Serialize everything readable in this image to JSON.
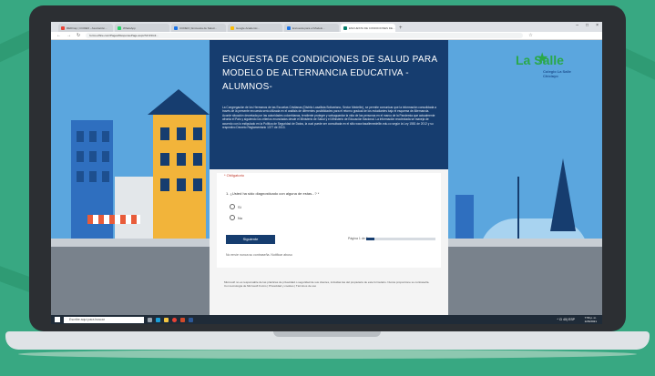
{
  "browser": {
    "tabs": [
      {
        "label": "REDCap | CCDEO - Asociación...",
        "color": "#e94235"
      },
      {
        "label": "WhatsApp",
        "color": "#25d366"
      },
      {
        "label": "CCDEO | Encuesta de Salud...",
        "color": "#1a73e8"
      },
      {
        "label": "Google Academic...",
        "color": "#fbbc04"
      },
      {
        "label": "Encuesta para el Modelo...",
        "color": "#1a73e8"
      },
      {
        "label": "ENCUESTA DE CONDICIONES DE...",
        "color": "#1a73e8",
        "active": true
      }
    ],
    "url": "forms.office.com/Pages/ResponsePage.aspx?id=Z1G3...",
    "window_controls": [
      "–",
      "□",
      "×"
    ]
  },
  "logo": {
    "main": "La Salle",
    "sub": "Colegio La Salle\nChiclayo"
  },
  "form": {
    "title": "ENCUESTA DE CONDICIONES DE SALUD PARA MODELO DE ALTERNANCIA EDUCATIVA -ALUMNOS-",
    "description": "La Congregación de los Hermanos de las Escuelas Cristianas (Distrito Lasallista Bolivariano, Sector Medellín), se permite comunicar que la información consolidada a través de la presente encuesta será utilizada en el análisis de diferentes posibilidades para el retorno gradual de los estudiantes bajo el esquema de Alternancia. Acorde situación decretada por las autoridades colombianas, tendiente proteger y salvaguardar la vida de las personas en el marco de la Pandemia que actualmente afronta el País y siguiendo los criterios enunciados desde el Ministerio de Salud y el Ministerio de Educación Nacional. La información recolectada se maneja de acuerdo con lo estipulado en la Política de Seguridad de Datos, la cual puede ser consultada en el sitio www.lasallemedellin.edu.co según la Ley 1581 de 2012 y su respectivo Decreto Reglamentario 1377 de 2013.",
    "required_label": "* Obligatorio",
    "question": "1. ¿Usted ha sido diagnosticado con alguna de estas...? *",
    "options": [
      "Sí",
      "No"
    ],
    "next_button": "Siguiente",
    "progress_label": "Página 1 de 8",
    "progress_fraction": 0.12,
    "note": "No envíe nunca su contraseña. Notificar abuso",
    "footer": "Microsoft no es responsable de las prácticas de privacidad o seguridad de sus clientes, incluidas las del propietario de este formulario. Nunca proporcione su contraseña. Con tecnología de Microsoft Forms | Privacidad y cookies | Términos de uso"
  },
  "taskbar": {
    "search_placeholder": "Escribe aquí para buscar",
    "tray": "^ ⊡ 40) ESP",
    "time": "7:56 p. m.",
    "date": "12/6/2021"
  },
  "colors": {
    "form_header": "#163d6f",
    "sky": "#5ba6de",
    "accent_green": "#2aa84a"
  }
}
